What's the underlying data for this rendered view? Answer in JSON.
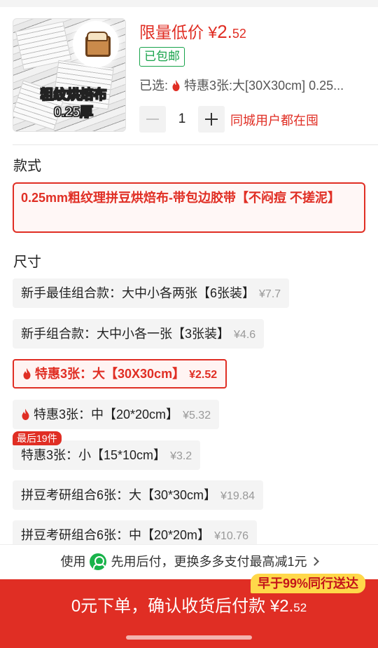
{
  "product": {
    "thumb_caption_line1": "粗纹烘焙布",
    "thumb_caption_line2": "0.25厚",
    "promo_label": "限量低价",
    "price_symbol": "¥",
    "price_int": "2.",
    "price_dec": "52",
    "free_shipping": "已包邮",
    "selected_prefix": "已选:",
    "selected_value": "特惠3张:大[30X30cm] 0.25...",
    "quantity": "1",
    "city_note": "同城用户都在囤"
  },
  "style_section": {
    "title": "款式",
    "option": "0.25mm粗纹理拼豆烘焙布-带包边胶带【不闷痘 不搓泥】"
  },
  "size_section": {
    "title": "尺寸",
    "options": [
      {
        "label": "新手最佳组合款：大中小各两张【6张装】",
        "price": "¥7.7",
        "selected": false,
        "hot": false
      },
      {
        "label": "新手组合款：大中小各一张【3张装】",
        "price": "¥4.6",
        "selected": false,
        "hot": false
      },
      {
        "label": "特惠3张：大【30X30cm】",
        "price": "¥2.52",
        "selected": true,
        "hot": true
      },
      {
        "label": "特惠3张：中【20*20cm】",
        "price": "¥5.32",
        "selected": false,
        "hot": true
      },
      {
        "label": "特惠3张：小【15*10cm】",
        "price": "¥3.2",
        "selected": false,
        "hot": false
      },
      {
        "label": "拼豆考研组合6张：大【30*30cm】",
        "price": "¥19.84",
        "selected": false,
        "hot": false
      },
      {
        "label": "拼豆考研组合6张：中【20*20m】",
        "price": "¥10.76",
        "selected": false,
        "hot": false
      }
    ],
    "stock_badge": "最后19件"
  },
  "paylater": {
    "prefix": "使用",
    "text": "先用后付，更换多多支付最高减1元"
  },
  "cta": {
    "badge": "早于99%同行送达",
    "label": "0元下单，确认收货后付款",
    "price_symbol": "¥",
    "price_int": "2.",
    "price_dec": "52"
  },
  "colors": {
    "accent": "#e02e24",
    "green": "#17a34a",
    "badge_yellow": "#ffd84a"
  },
  "icons": [
    "flame-icon",
    "plus-icon",
    "minus-icon",
    "chevron-right-icon",
    "pay-logo-icon"
  ]
}
